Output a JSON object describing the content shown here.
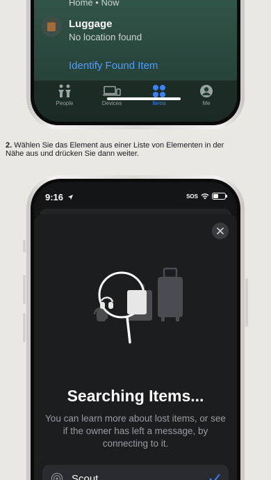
{
  "top_screen": {
    "previous_row_subtitle": "Home • Now",
    "item": {
      "title": "Luggage",
      "subtitle": "No location found"
    },
    "identify_link": "Identify Found Item",
    "tabs": [
      {
        "label": "People",
        "icon": "people-icon"
      },
      {
        "label": "Devices",
        "icon": "devices-icon"
      },
      {
        "label": "Items",
        "icon": "items-icon",
        "active": true
      },
      {
        "label": "Me",
        "icon": "me-icon"
      }
    ]
  },
  "instruction": {
    "number": "2.",
    "text": " Wählen Sie das Element aus einer Liste von Elementen in der Nähe aus und drücken Sie dann weiter."
  },
  "bottom_screen": {
    "status": {
      "time": "9:16",
      "sos": "SOS"
    },
    "title": "Searching Items...",
    "description": "You can learn more about lost items, or see if the owner has left a message, by connecting to it.",
    "items": [
      {
        "name": "Scout",
        "icon": "radar-icon",
        "selected": true
      }
    ]
  },
  "colors": {
    "accent": "#3b82f6",
    "link": "#4f9dff",
    "top_screen_bg": "#2b4a40",
    "sheet_bg": "#1c1d1f"
  }
}
